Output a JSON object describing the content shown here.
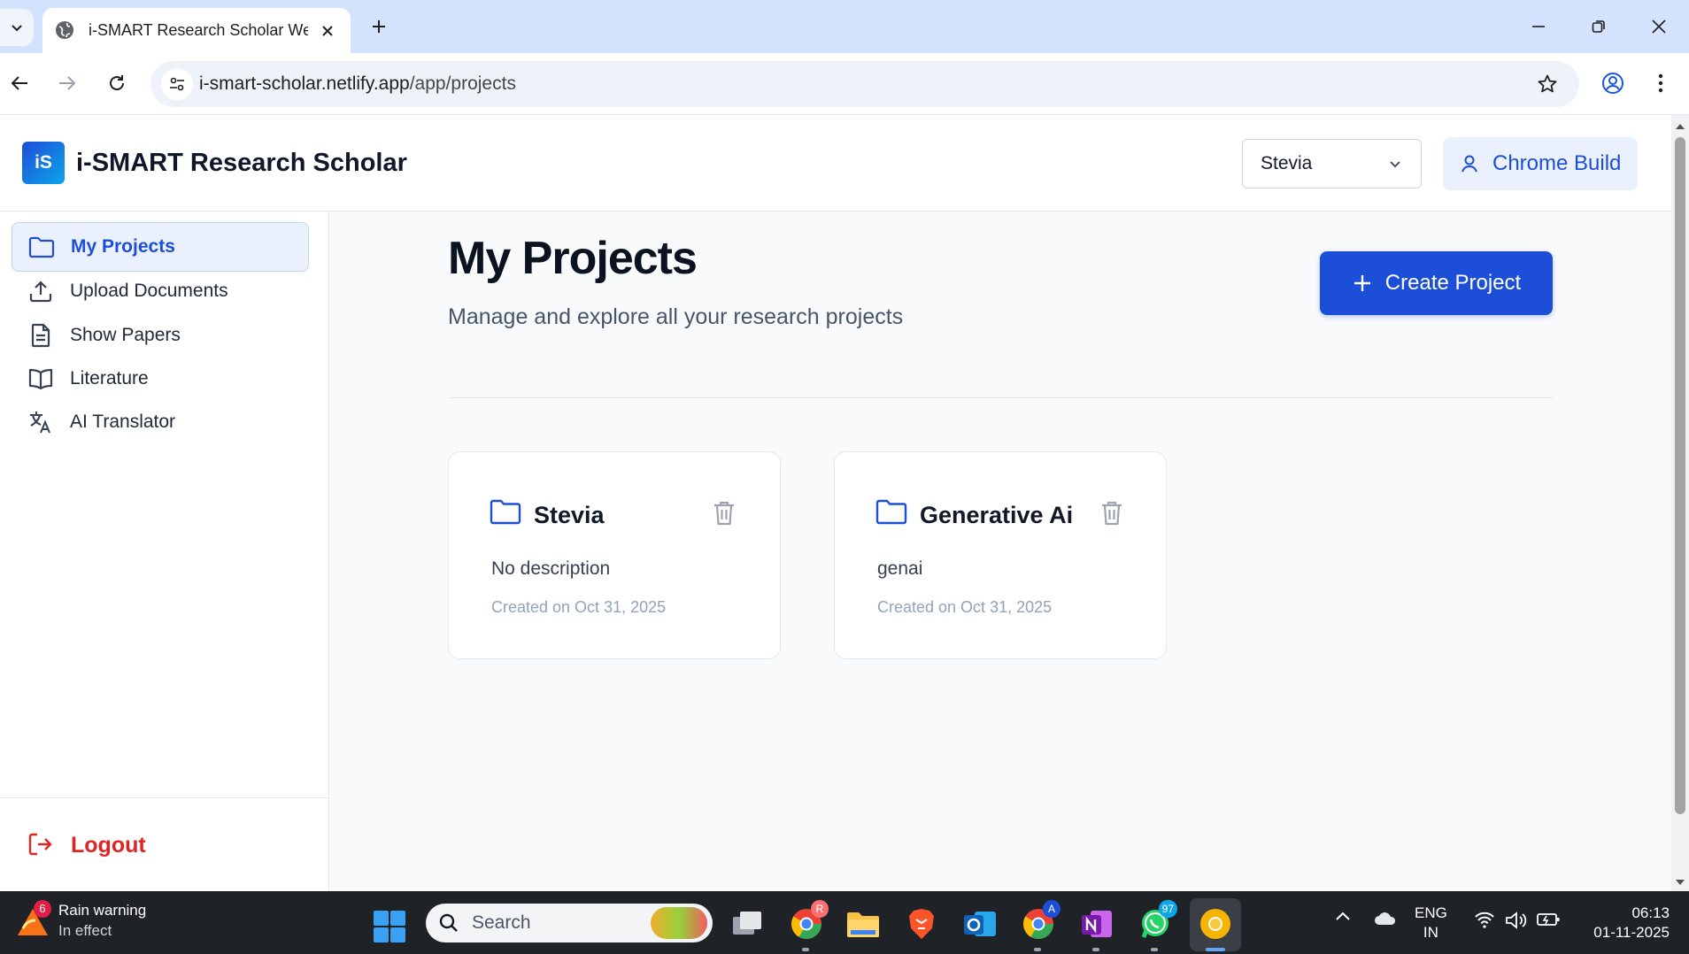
{
  "browser": {
    "tab_title": "i-SMART Research Scholar Web",
    "url_host": "i-smart-scholar.netlify.app",
    "url_path": "/app/projects"
  },
  "header": {
    "logo_text": "iS",
    "app_title": "i-SMART Research Scholar",
    "project_select_value": "Stevia",
    "user_button_label": "Chrome Build"
  },
  "sidebar": {
    "items": [
      {
        "label": "My Projects",
        "icon": "folder-icon",
        "active": true
      },
      {
        "label": "Upload Documents",
        "icon": "upload-icon",
        "active": false
      },
      {
        "label": "Show Papers",
        "icon": "document-icon",
        "active": false
      },
      {
        "label": "Literature",
        "icon": "book-icon",
        "active": false
      },
      {
        "label": "AI Translator",
        "icon": "translate-icon",
        "active": false
      }
    ],
    "logout_label": "Logout"
  },
  "main": {
    "title": "My Projects",
    "subtitle": "Manage and explore all your research projects",
    "create_button_label": "Create Project",
    "projects": [
      {
        "name": "Stevia",
        "description": "No description",
        "created": "Created on Oct 31, 2025"
      },
      {
        "name": "Generative Ai",
        "description": "genai",
        "created": "Created on Oct 31, 2025"
      }
    ]
  },
  "taskbar": {
    "weather_title": "Rain warning",
    "weather_status": "In effect",
    "weather_badge": "6",
    "search_placeholder": "Search",
    "chrome_profile_badge": "R",
    "chrome2_profile_badge": "A",
    "whatsapp_badge": "97",
    "lang_line1": "ENG",
    "lang_line2": "IN",
    "time": "06:13",
    "date": "01-11-2025"
  },
  "colors": {
    "accent": "#1d4ed8",
    "logout": "#dc2626",
    "active_nav_bg": "#eaf1fd"
  }
}
